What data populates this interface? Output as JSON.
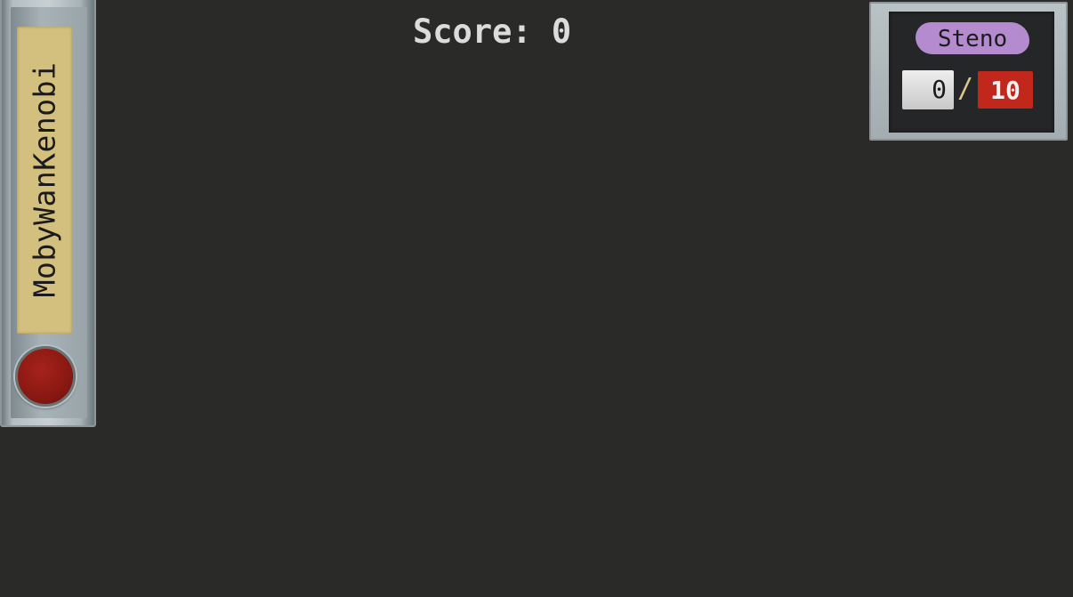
{
  "score": {
    "text": "Score: 0"
  },
  "player": {
    "name": "MobyWanKenobi"
  },
  "progress": {
    "mode": "Steno",
    "current": "0",
    "separator": "/",
    "total": "10"
  },
  "colors": {
    "background": "#2a2a29",
    "nameplate": "#d3bf7e",
    "button_red": "#8c1912",
    "mode_badge": "#b58bcf",
    "total_badge": "#c2271b"
  },
  "icons": {
    "action_button": "red-round-button"
  }
}
